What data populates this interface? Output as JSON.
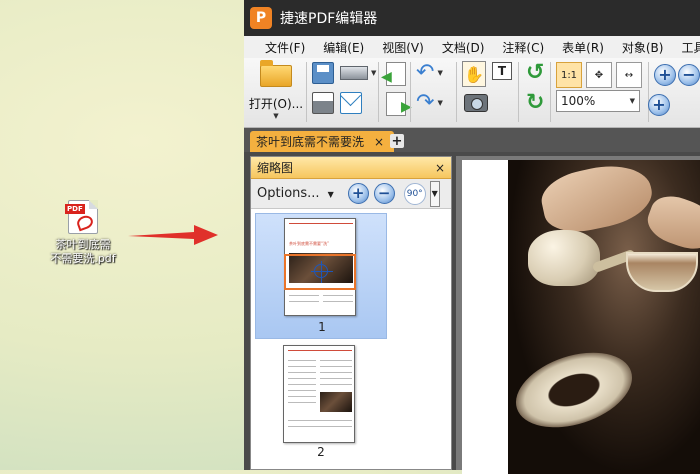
{
  "desktop": {
    "file_icon": "pdf-file-icon",
    "file_label_line1": "茶叶到底需",
    "file_label_line2": "不需要洗.pdf"
  },
  "window": {
    "logo_letter": "P",
    "title": "捷速PDF编辑器"
  },
  "menu": [
    "文件(F)",
    "编辑(E)",
    "视图(V)",
    "文档(D)",
    "注释(C)",
    "表单(R)",
    "对象(B)",
    "工具(T)"
  ],
  "toolbar": {
    "open_label": "打开(O)...",
    "zoom_value": "100%",
    "fit_actual_label": "1:1"
  },
  "tabs": {
    "active_tab": "茶叶到底需不需要洗",
    "close_glyph": "×",
    "new_tab_glyph": "+"
  },
  "thumbnail_panel": {
    "title": "缩略图",
    "close_glyph": "×",
    "options_label": "Options...",
    "rotate_label": "90°",
    "pages": [
      "1",
      "2"
    ],
    "thumb1_title": "茶叶到底需不需要“洗”"
  },
  "colors": {
    "accent": "#f4b03f",
    "title_bar": "#2b2b2b",
    "logo": "#f08324",
    "arrow": "#e0302a"
  }
}
